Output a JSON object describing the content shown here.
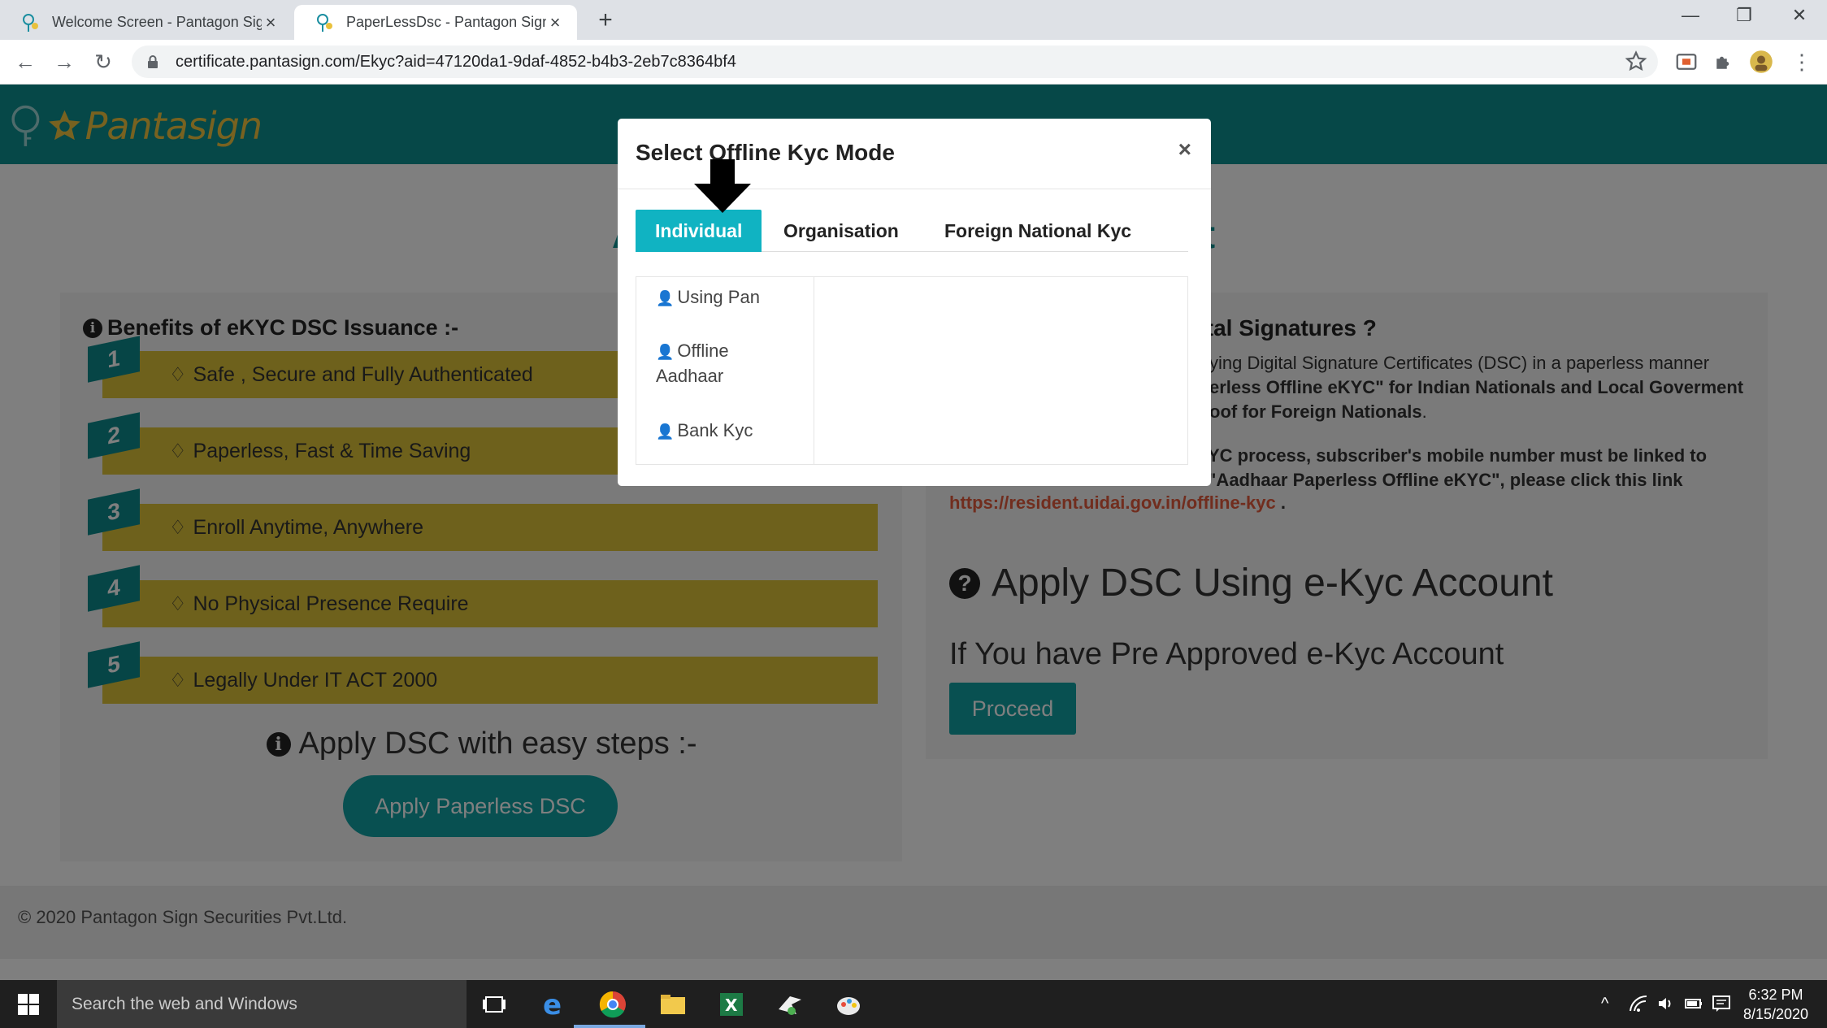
{
  "browser": {
    "tabs": [
      {
        "title": "Welcome Screen - Pantagon Sign"
      },
      {
        "title": "PaperLessDsc - Pantagon Sign Se"
      }
    ],
    "new_tab": "+",
    "url": "certificate.pantasign.com/Ekyc?aid=47120da1-9daf-4852-b4b3-2eb7c8364bf4"
  },
  "site": {
    "brand": "Pantasign",
    "page_title": "Apply DSC Using e-Kyc Account",
    "benefits": {
      "heading": "Benefits of eKYC DSC Issuance :-",
      "items": [
        {
          "num": "1",
          "text": "Safe , Secure and Fully Authenticated"
        },
        {
          "num": "2",
          "text": "Paperless, Fast & Time Saving"
        },
        {
          "num": "3",
          "text": "Enroll Anytime, Anywhere"
        },
        {
          "num": "4",
          "text": "No Physical Presence Require"
        },
        {
          "num": "5",
          "text": "Legally Under IT ACT 2000"
        }
      ]
    },
    "steps_heading": "Apply DSC with easy steps :-",
    "apply_button": "Apply Paperless DSC",
    "right": {
      "heading": "ital Signatures ?",
      "p1_normal": "ying Digital Signature Certificates (DSC) in a paperless manner",
      "p1_bold": "erless Offline eKYC\" for Indian Nationals and Local Goverment",
      "p1_bold2": "oof for Foreign Nationals",
      "p2_line1": "YC process, subscriber's mobile number must be linked to",
      "p2_line2": "\"Aadhaar Paperless Offline eKYC\", please click this link",
      "link": "https://resident.uidai.gov.in/offline-kyc",
      "apply_heading": "Apply DSC Using e-Kyc Account",
      "pre_approved": "If You have Pre Approved e-Kyc Account",
      "proceed": "Proceed"
    },
    "footer": "© 2020 Pantagon Sign Securities Pvt.Ltd."
  },
  "modal": {
    "title": "Select Offline Kyc Mode",
    "close": "×",
    "tabs": [
      {
        "label": "Individual",
        "active": true
      },
      {
        "label": "Organisation",
        "active": false
      },
      {
        "label": "Foreign National Kyc",
        "active": false
      }
    ],
    "options": [
      {
        "label": "Using Pan"
      },
      {
        "label": "Offline Aadhaar"
      },
      {
        "label": "Bank Kyc"
      }
    ]
  },
  "taskbar": {
    "search_placeholder": "Search the web and Windows",
    "time": "6:32 PM",
    "date": "8/15/2020"
  },
  "colors": {
    "teal": "#0d9191",
    "button_teal": "#10a0a3",
    "benefit_yellow": "#ddc238",
    "active_tab": "#10b3c2",
    "link_orange": "#e25a3c"
  }
}
